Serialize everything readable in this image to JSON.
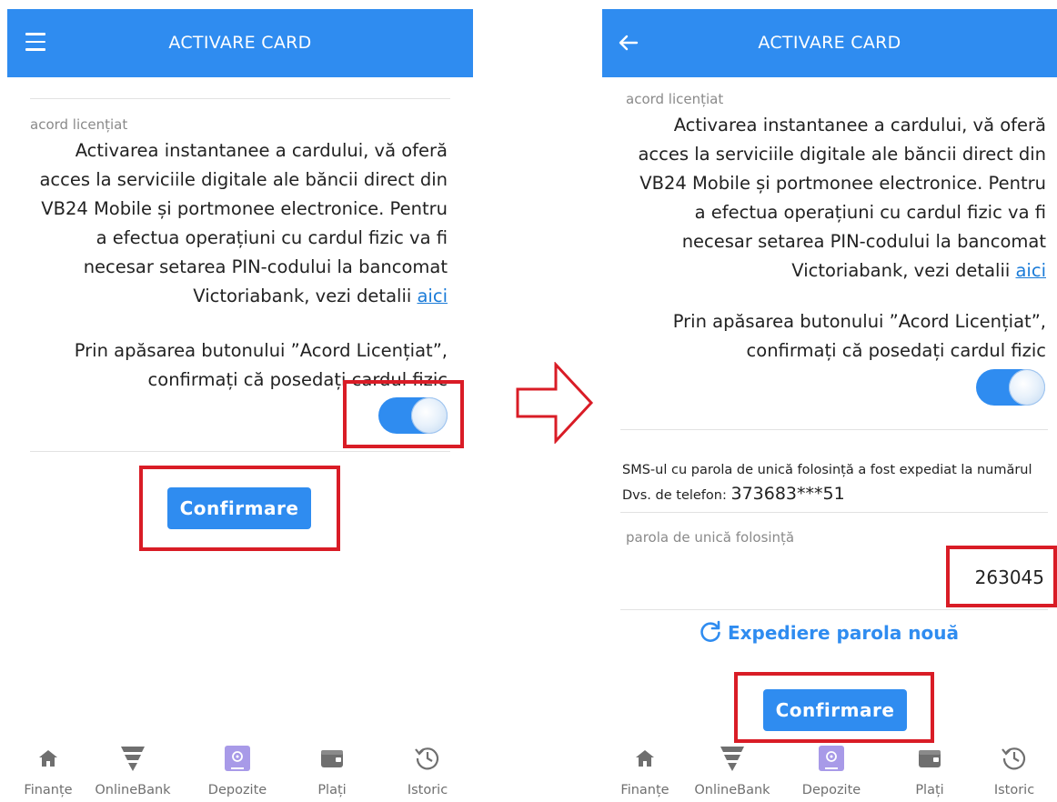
{
  "left_screen": {
    "header": {
      "title": "ACTIVARE CARD",
      "menu_icon": "hamburger-icon"
    },
    "agreement_label": "acord licențiat",
    "agreement_text_lines": [
      "Activarea instantanee a cardului, vă oferă",
      "acces la serviciile digitale ale băncii direct din",
      "VB24 Mobile și portmonee electronice. Pentru",
      "a efectua operațiuni cu cardul fizic va fi",
      "necesar setarea PIN-codului la bancomat",
      "Victoriabank, vezi detalii"
    ],
    "details_link": "aici",
    "confirm_text_lines": [
      "Prin apăsarea butonului ”Acord Licențiat”,",
      "confirmați că posedați cardul fizic"
    ],
    "toggle_on": true,
    "confirm_button": "Confirmare"
  },
  "right_screen": {
    "header": {
      "title": "ACTIVARE CARD",
      "back_icon": "arrow-left-icon"
    },
    "agreement_label": "acord licențiat",
    "agreement_text_lines": [
      "Activarea instantanee a cardului, vă oferă",
      "acces la serviciile digitale ale băncii direct din",
      "VB24 Mobile și portmonee electronice. Pentru",
      "a efectua operațiuni cu cardul fizic va fi",
      "necesar setarea PIN-codului la bancomat",
      "Victoriabank, vezi detalii"
    ],
    "details_link": "aici",
    "confirm_text_lines": [
      "Prin apăsarea butonului ”Acord Licențiat”,",
      "confirmați că posedați cardul fizic"
    ],
    "toggle_on": true,
    "sms_line1": "SMS-ul cu parola de unică folosință a fost expediat la numărul",
    "sms_line2_prefix": "Dvs. de telefon:",
    "phone_number": "373683***51",
    "otp_label": "parola de unică folosință",
    "otp_value": "263045",
    "resend_label": "Expediere parola nouă",
    "confirm_button": "Confirmare"
  },
  "bottom_nav": [
    {
      "label": "Finanțe",
      "icon": "home-icon"
    },
    {
      "label": "OnlineBank",
      "icon": "victoriabank-logo-icon"
    },
    {
      "label": "Depozite",
      "icon": "deposit-safe-icon"
    },
    {
      "label": "Plați",
      "icon": "wallet-icon"
    },
    {
      "label": "Istoric",
      "icon": "history-icon"
    }
  ],
  "colors": {
    "accent": "#2f8cf0",
    "highlight": "#d91c26",
    "link": "#1a7bd8"
  }
}
